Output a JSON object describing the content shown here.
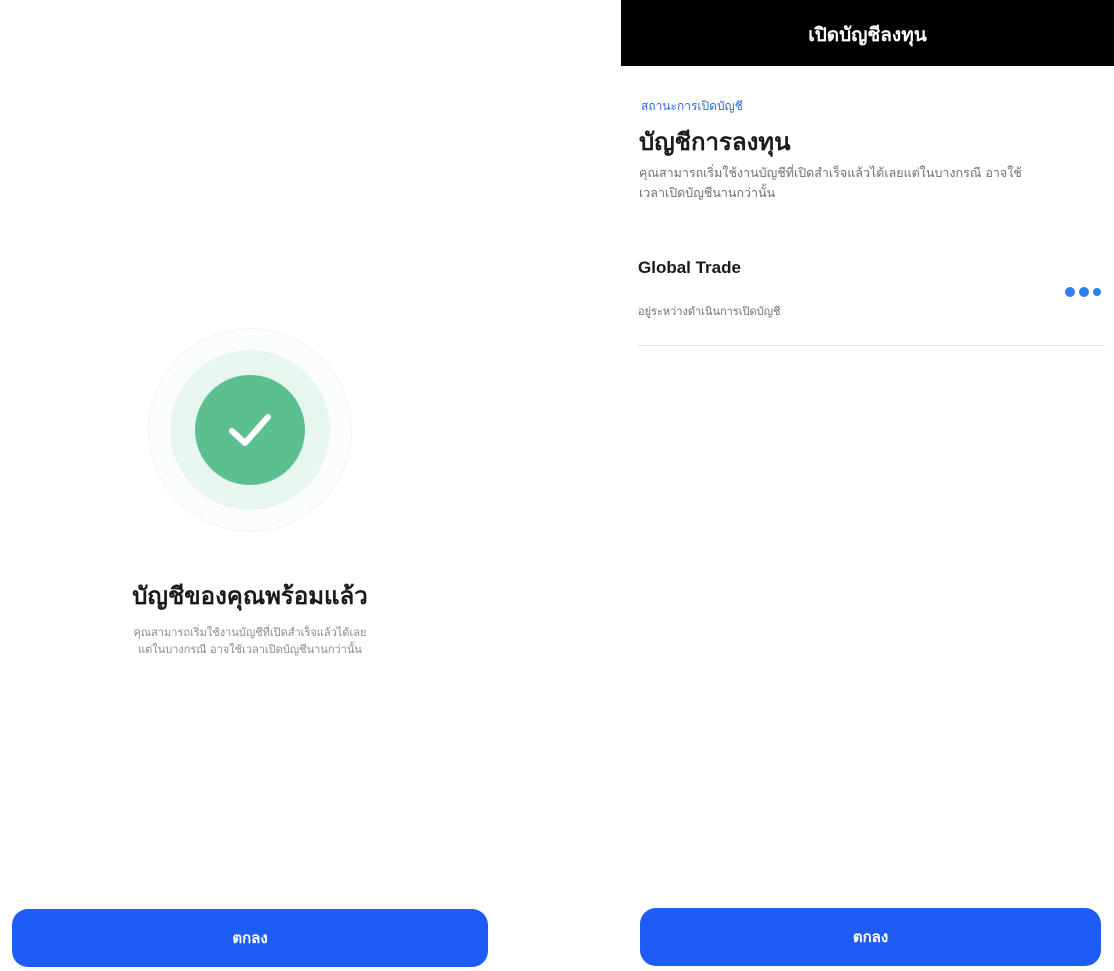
{
  "success_screen": {
    "title": "บัญชีของคุณพร้อมแล้ว",
    "description_lines": [
      "คุณสามารถเริ่มใช้งานบัญชีที่เปิดสำเร็จแล้วได้เลย",
      "แต่ในบางกรณี อาจใช้เวลาเปิดบัญชีนานกว่านั้น"
    ],
    "ok_button_label": "ตกลง",
    "icon": "check-icon",
    "accent_color": "#5cbf8f"
  },
  "status_screen": {
    "header_title": "เปิดบัญชีลงทุน",
    "status_label": "สถานะการเปิดบัญชี",
    "section_title": "บัญชีการลงทุน",
    "description_lines": [
      "คุณสามารถเริ่มใช้งานบัญชีที่เปิดสำเร็จแล้วได้เลยแต่ในบางกรณี อาจใช้",
      "เวลาเปิดบัญชีนานกว่านั้น"
    ],
    "accounts": [
      {
        "name": "Global Trade",
        "status": "อยู่ระหว่างดำเนินการเปิดบัญชี",
        "indicator": "loading-dots-icon"
      }
    ],
    "ok_button_label": "ตกลง",
    "link_color": "#2d6ae3"
  },
  "colors": {
    "primary_button": "#1f5cf5",
    "header_background": "#000000"
  }
}
